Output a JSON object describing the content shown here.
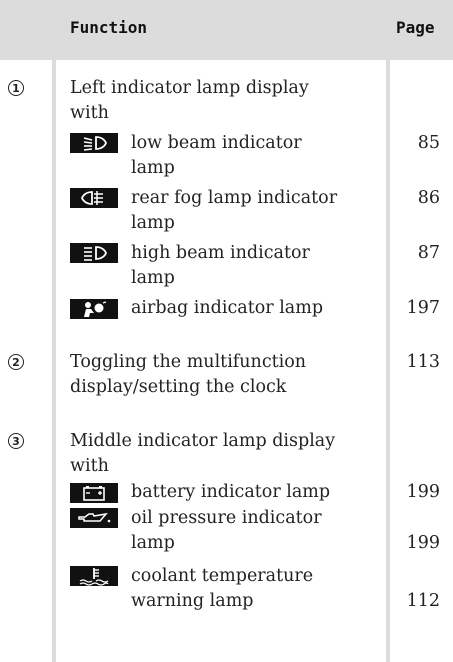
{
  "header": {
    "function": "Function",
    "page": "Page"
  },
  "rows": [
    {
      "number": "1",
      "text_lines": [
        "Left indicator lamp display",
        "with"
      ],
      "page": ""
    },
    {
      "text_lines": [
        "low beam indicator",
        "lamp"
      ],
      "icon": "low-beam-icon",
      "page": "85"
    },
    {
      "text_lines": [
        "rear fog lamp indicator",
        "lamp"
      ],
      "icon": "rear-fog-lamp-icon",
      "page": "86"
    },
    {
      "text_lines": [
        "high beam indicator",
        "lamp"
      ],
      "icon": "high-beam-icon",
      "page": "87"
    },
    {
      "text_lines": [
        "airbag indicator lamp"
      ],
      "icon": "airbag-icon",
      "page": "197"
    },
    {
      "number": "2",
      "text_lines": [
        "Toggling the multifunction",
        "display/setting the clock"
      ],
      "page": "113"
    },
    {
      "number": "3",
      "text_lines": [
        "Middle indicator lamp display",
        "with"
      ],
      "page": ""
    },
    {
      "text_lines": [
        "battery indicator lamp"
      ],
      "icon": "battery-icon",
      "page": "199"
    },
    {
      "text_lines": [
        "oil pressure indicator",
        "lamp"
      ],
      "icon": "oil-pressure-icon",
      "page": "199"
    },
    {
      "text_lines": [
        "coolant temperature",
        "warning lamp"
      ],
      "icon": "coolant-temperature-icon",
      "page": "112"
    }
  ],
  "colors": {
    "header_bg": "#dcdcdc",
    "icon_bg": "#111111",
    "rule": "#dcdcdc"
  }
}
